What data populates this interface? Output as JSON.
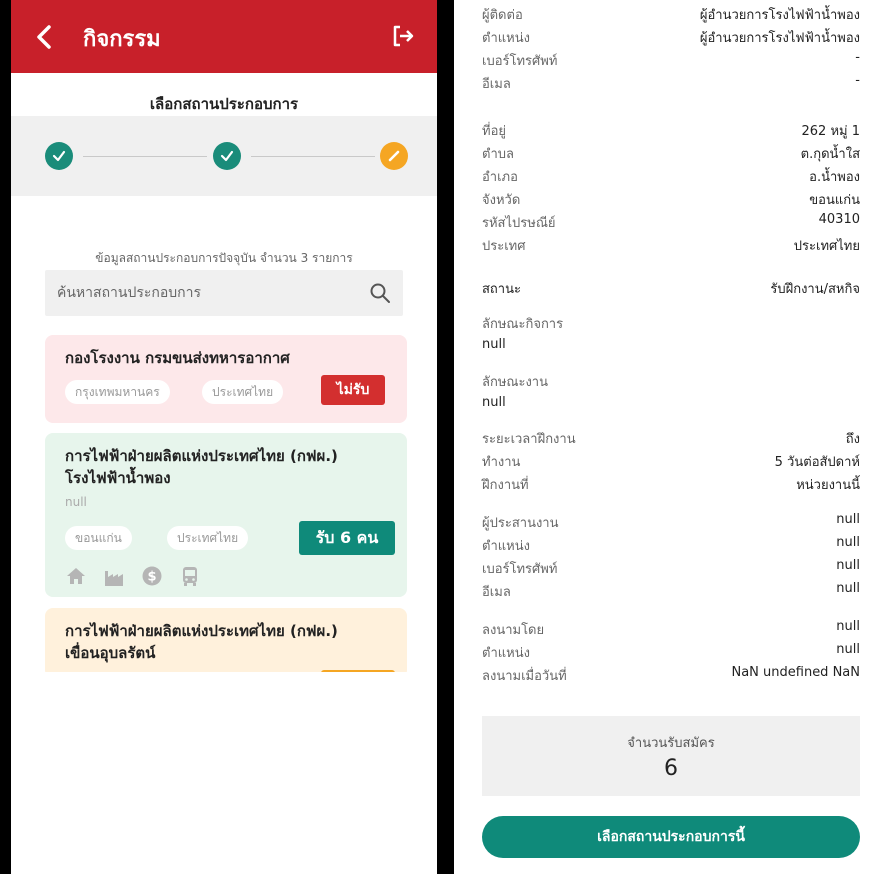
{
  "left": {
    "header": {
      "title": "กิจกรรม"
    },
    "step_title": "เลือกสถานประกอบการ",
    "info_count": "ข้อมูลสถานประกอบการปัจจุบัน จำนวน 3 รายการ",
    "search": {
      "placeholder": "ค้นหาสถานประกอบการ"
    },
    "cards": [
      {
        "title": "กองโรงงาน กรมขนส่งทหารอากาศ",
        "chips": [
          "กรุงเทพมหานคร",
          "ประเทศไทย"
        ],
        "status": "ไม่รับ",
        "status_color": "#d32f2f",
        "bg_color": "#fde8ea"
      },
      {
        "title_line1": "การไฟฟ้าฝ่ายผลิตแห่งประเทศไทย (กฟผ.)",
        "title_line2": "โรงไฟฟ้าน้ำพอง",
        "subtitle": "null",
        "chips": [
          "ขอนแก่น",
          "ประเทศไทย"
        ],
        "status": "รับ 6 คน",
        "status_color": "#0f8a7a",
        "amenities": [
          "home-icon",
          "factory-icon",
          "money-icon",
          "bus-icon"
        ],
        "bg_color": "#e7f5ec"
      },
      {
        "title_line1": "การไฟฟ้าฝ่ายผลิตแห่งประเทศไทย (กฟผ.)",
        "title_line2": "เขื่อนอุบลรัตน์",
        "bg_color": "#fff1dc"
      }
    ]
  },
  "right": {
    "contact": [
      {
        "label": "ผู้ติดต่อ",
        "value": "ผู้อำนวยการโรงไฟฟ้าน้ำพอง"
      },
      {
        "label": "ตำแหน่ง",
        "value": "ผู้อำนวยการโรงไฟฟ้าน้ำพอง"
      },
      {
        "label": "เบอร์โทรศัพท์",
        "value": "-"
      },
      {
        "label": "อีเมล",
        "value": "-"
      }
    ],
    "address": [
      {
        "label": "ที่อยู่",
        "value": "262 หมู่ 1"
      },
      {
        "label": "ตำบล",
        "value": "ต.กุดน้ำใส"
      },
      {
        "label": "อำเภอ",
        "value": "อ.น้ำพอง"
      },
      {
        "label": "จังหวัด",
        "value": "ขอนแก่น"
      },
      {
        "label": "รหัสไปรษณีย์",
        "value": "40310"
      },
      {
        "label": "ประเทศ",
        "value": "ประเทศไทย"
      }
    ],
    "status": {
      "label": "สถานะ",
      "value": "รับฝึกงาน/สหกิจ"
    },
    "business_type": {
      "label": "ลักษณะกิจการ",
      "value": "null"
    },
    "job_type": {
      "label": "ลักษณะงาน",
      "value": "null"
    },
    "training": [
      {
        "label": "ระยะเวลาฝึกงาน",
        "value": "ถึง"
      },
      {
        "label": "ทำงาน",
        "value": "5  วันต่อสัปดาห์"
      },
      {
        "label": "ฝึกงานที่",
        "value": "หน่วยงานนี้"
      }
    ],
    "coordinator": [
      {
        "label": "ผู้ประสานงาน",
        "value": "null"
      },
      {
        "label": "ตำแหน่ง",
        "value": "null"
      },
      {
        "label": "เบอร์โทรศัพท์",
        "value": "null"
      },
      {
        "label": "อีเมล",
        "value": "null"
      }
    ],
    "signature": [
      {
        "label": "ลงนามโดย",
        "value": "null"
      },
      {
        "label": "ตำแหน่ง",
        "value": "null"
      },
      {
        "label": "ลงนามเมื่อวันที่",
        "value": "NaN undefined NaN"
      }
    ],
    "apply": {
      "label": "จำนวนรับสมัคร",
      "count": "6"
    },
    "select_button": "เลือกสถานประกอบการนี้"
  }
}
